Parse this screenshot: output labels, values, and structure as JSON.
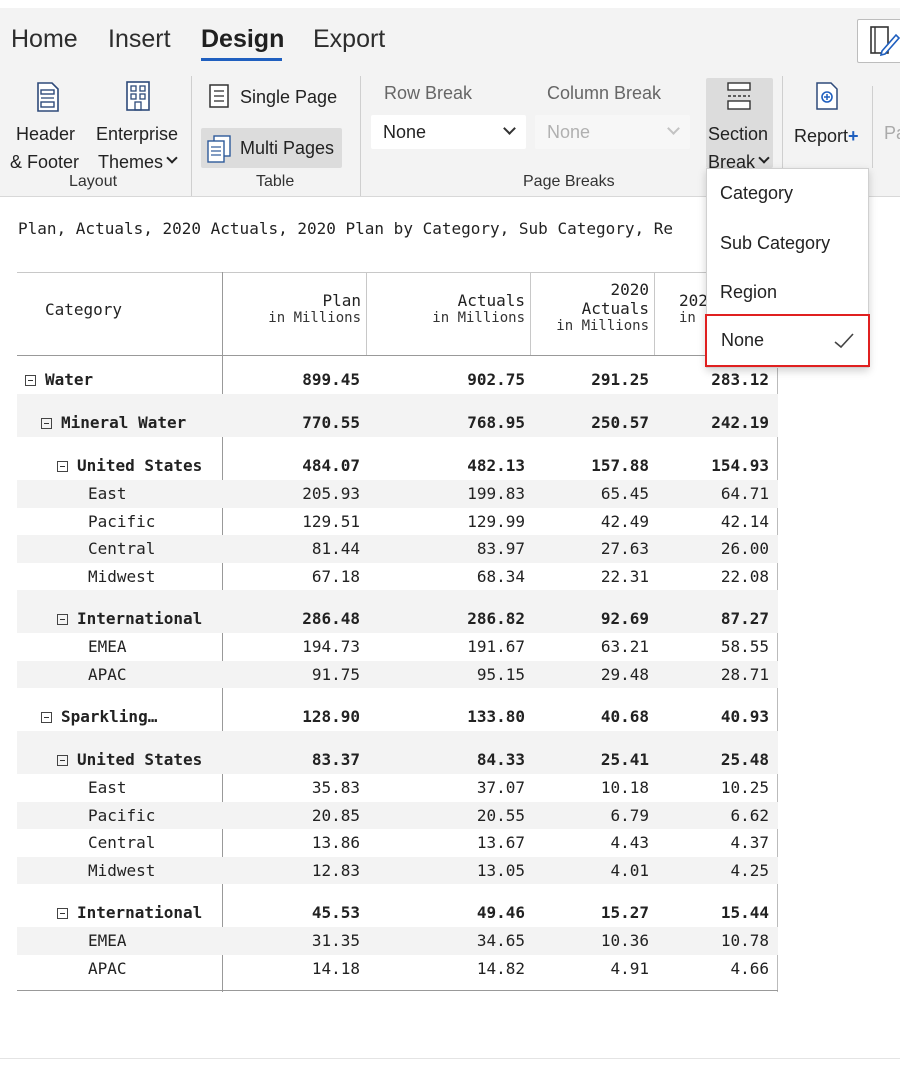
{
  "tabs": [
    "Home",
    "Insert",
    "Design",
    "Export"
  ],
  "ribbon": {
    "header_footer": [
      "Header",
      "& Footer"
    ],
    "enterprise_themes": [
      "Enterprise",
      "Themes"
    ],
    "layout_group": "Layout",
    "single_page": "Single Page",
    "multi_pages": "Multi Pages",
    "table_group": "Table",
    "row_break_label": "Row Break",
    "row_break_value": "None",
    "column_break_label": "Column Break",
    "column_break_value": "None",
    "page_breaks_group": "Page Breaks",
    "section_break": [
      "Section",
      "Break"
    ],
    "report_plus": "Report",
    "report_plus_sign": "+",
    "cut_label": "Pa"
  },
  "dropdown": {
    "items": [
      "Category",
      "Sub Category",
      "Region",
      "None"
    ],
    "selected": "None"
  },
  "report": {
    "title": "Plan, Actuals, 2020 Actuals, 2020 Plan by Category, Sub Category, Re",
    "headers": [
      {
        "main": "Category",
        "sub": ""
      },
      {
        "main": "Plan",
        "sub": "in Millions"
      },
      {
        "main": "Actuals",
        "sub": "in Millions"
      },
      {
        "main": "2020",
        "main2": "Actuals",
        "sub": "in Millions"
      },
      {
        "main": "202",
        "sub": "in"
      }
    ],
    "rows": [
      {
        "label": "Water",
        "level": 0,
        "toggle": true,
        "bold": true,
        "shade": false,
        "values": [
          "899.45",
          "902.75",
          "291.25",
          "283.12"
        ]
      },
      {
        "label": "Mineral Water",
        "level": 1,
        "toggle": true,
        "bold": true,
        "shade": true,
        "values": [
          "770.55",
          "768.95",
          "250.57",
          "242.19"
        ]
      },
      {
        "label": "United States",
        "level": 2,
        "toggle": true,
        "bold": true,
        "shade": false,
        "values": [
          "484.07",
          "482.13",
          "157.88",
          "154.93"
        ]
      },
      {
        "label": "East",
        "level": 3,
        "toggle": false,
        "bold": false,
        "shade": true,
        "values": [
          "205.93",
          "199.83",
          "65.45",
          "64.71"
        ]
      },
      {
        "label": "Pacific",
        "level": 3,
        "toggle": false,
        "bold": false,
        "shade": false,
        "values": [
          "129.51",
          "129.99",
          "42.49",
          "42.14"
        ]
      },
      {
        "label": "Central",
        "level": 3,
        "toggle": false,
        "bold": false,
        "shade": true,
        "values": [
          "81.44",
          "83.97",
          "27.63",
          "26.00"
        ]
      },
      {
        "label": "Midwest",
        "level": 3,
        "toggle": false,
        "bold": false,
        "shade": false,
        "values": [
          "67.18",
          "68.34",
          "22.31",
          "22.08"
        ]
      },
      {
        "label": "International",
        "level": 2,
        "toggle": true,
        "bold": true,
        "shade": true,
        "values": [
          "286.48",
          "286.82",
          "92.69",
          "87.27"
        ]
      },
      {
        "label": "EMEA",
        "level": 3,
        "toggle": false,
        "bold": false,
        "shade": false,
        "values": [
          "194.73",
          "191.67",
          "63.21",
          "58.55"
        ]
      },
      {
        "label": "APAC",
        "level": 3,
        "toggle": false,
        "bold": false,
        "shade": true,
        "values": [
          "91.75",
          "95.15",
          "29.48",
          "28.71"
        ]
      },
      {
        "label": "Sparkling…",
        "level": 1,
        "toggle": true,
        "bold": true,
        "shade": false,
        "values": [
          "128.90",
          "133.80",
          "40.68",
          "40.93"
        ]
      },
      {
        "label": "United States",
        "level": 2,
        "toggle": true,
        "bold": true,
        "shade": true,
        "values": [
          "83.37",
          "84.33",
          "25.41",
          "25.48"
        ]
      },
      {
        "label": "East",
        "level": 3,
        "toggle": false,
        "bold": false,
        "shade": false,
        "values": [
          "35.83",
          "37.07",
          "10.18",
          "10.25"
        ]
      },
      {
        "label": "Pacific",
        "level": 3,
        "toggle": false,
        "bold": false,
        "shade": true,
        "values": [
          "20.85",
          "20.55",
          "6.79",
          "6.62"
        ]
      },
      {
        "label": "Central",
        "level": 3,
        "toggle": false,
        "bold": false,
        "shade": false,
        "values": [
          "13.86",
          "13.67",
          "4.43",
          "4.37"
        ]
      },
      {
        "label": "Midwest",
        "level": 3,
        "toggle": false,
        "bold": false,
        "shade": true,
        "values": [
          "12.83",
          "13.05",
          "4.01",
          "4.25"
        ]
      },
      {
        "label": "International",
        "level": 2,
        "toggle": true,
        "bold": true,
        "shade": false,
        "values": [
          "45.53",
          "49.46",
          "15.27",
          "15.44"
        ]
      },
      {
        "label": "EMEA",
        "level": 3,
        "toggle": false,
        "bold": false,
        "shade": true,
        "values": [
          "31.35",
          "34.65",
          "10.36",
          "10.78"
        ]
      },
      {
        "label": "APAC",
        "level": 3,
        "toggle": false,
        "bold": false,
        "shade": false,
        "values": [
          "14.18",
          "14.82",
          "4.91",
          "4.66"
        ]
      }
    ]
  },
  "colors": {
    "accent": "#1f5fbf",
    "highlight": "#e02020",
    "ribbon_bg": "#f3f3f3",
    "row_shade": "#f3f3f3"
  }
}
